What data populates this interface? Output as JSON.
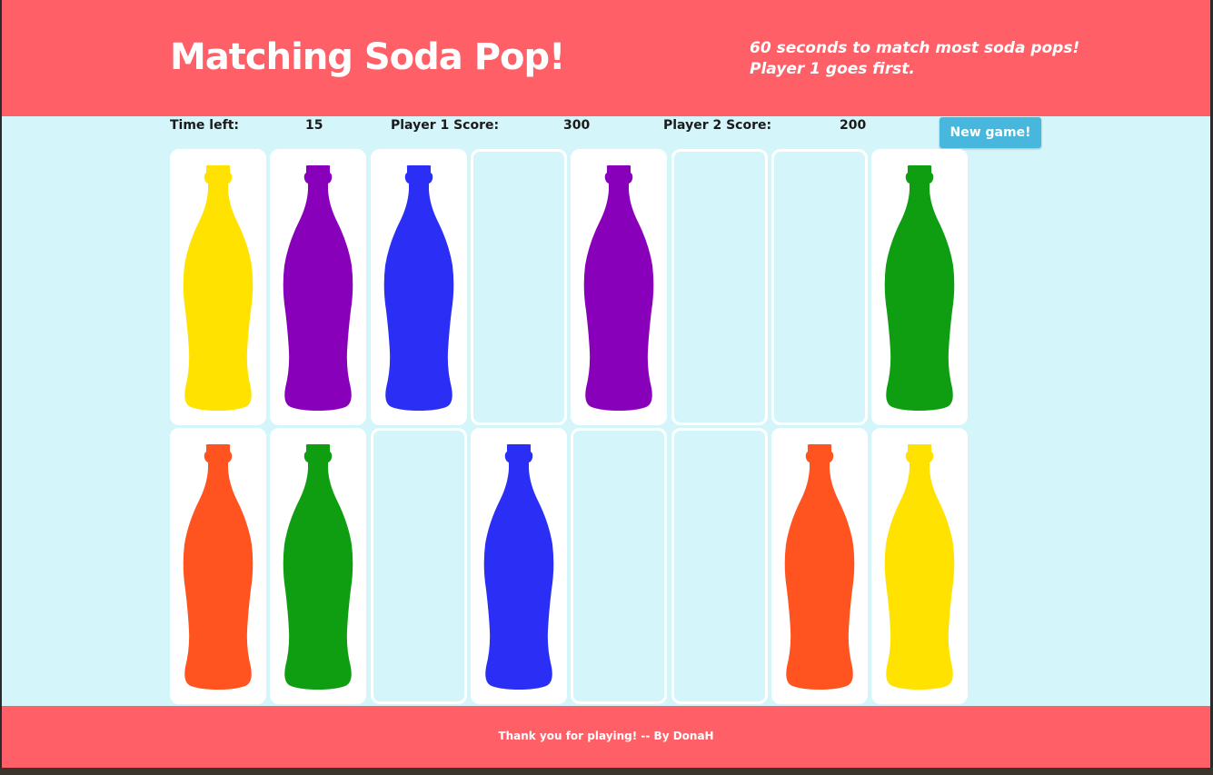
{
  "header": {
    "title": "Matching Soda Pop!",
    "tagline_line1": "60 seconds to match most soda pops!",
    "tagline_line2": "Player 1 goes first."
  },
  "scorebar": {
    "time_label": "Time left:",
    "time_value": "15",
    "p1_label": "Player 1 Score:",
    "p1_value": "300",
    "p2_label": "Player 2 Score:",
    "p2_value": "200",
    "new_game_label": "New game!"
  },
  "colors": {
    "yellow": "#ffe200",
    "purple": "#8900bb",
    "blue": "#2b2ef5",
    "green": "#0f9e12",
    "orange": "#ff541f",
    "header_bg": "#ff5f67",
    "board_bg": "#d4f6fb"
  },
  "cards": [
    {
      "state": "revealed",
      "color": "yellow"
    },
    {
      "state": "revealed",
      "color": "purple"
    },
    {
      "state": "revealed",
      "color": "blue"
    },
    {
      "state": "hidden",
      "color": ""
    },
    {
      "state": "revealed",
      "color": "purple"
    },
    {
      "state": "hidden",
      "color": ""
    },
    {
      "state": "hidden",
      "color": ""
    },
    {
      "state": "revealed",
      "color": "green"
    },
    {
      "state": "revealed",
      "color": "orange"
    },
    {
      "state": "revealed",
      "color": "green"
    },
    {
      "state": "hidden",
      "color": ""
    },
    {
      "state": "revealed",
      "color": "blue"
    },
    {
      "state": "hidden",
      "color": ""
    },
    {
      "state": "hidden",
      "color": ""
    },
    {
      "state": "revealed",
      "color": "orange"
    },
    {
      "state": "revealed",
      "color": "yellow"
    }
  ],
  "footer": {
    "text": "Thank you for playing! -- By DonaH"
  }
}
